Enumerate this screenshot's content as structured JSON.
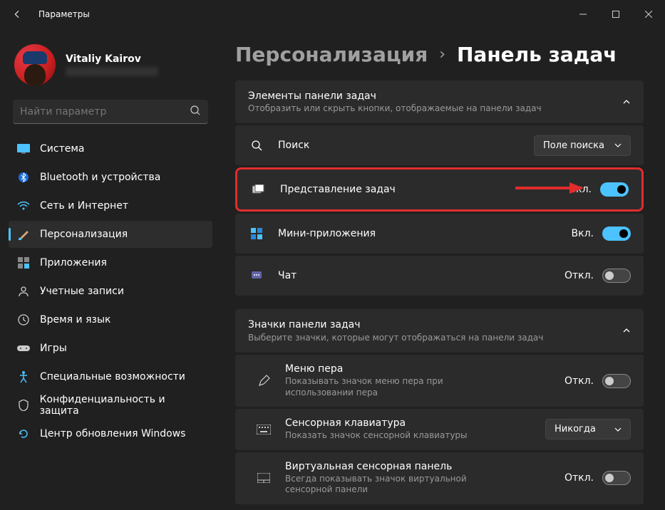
{
  "title": "Параметры",
  "user": {
    "name": "Vitaliy Kairov"
  },
  "search": {
    "placeholder": "Найти параметр"
  },
  "nav": [
    {
      "label": "Система",
      "icon": "display"
    },
    {
      "label": "Bluetooth и устройства",
      "icon": "bluetooth"
    },
    {
      "label": "Сеть и Интернет",
      "icon": "wifi"
    },
    {
      "label": "Персонализация",
      "icon": "brush",
      "active": true
    },
    {
      "label": "Приложения",
      "icon": "apps"
    },
    {
      "label": "Учетные записи",
      "icon": "user"
    },
    {
      "label": "Время и язык",
      "icon": "clock"
    },
    {
      "label": "Игры",
      "icon": "game"
    },
    {
      "label": "Специальные возможности",
      "icon": "accessibility"
    },
    {
      "label": "Конфиденциальность и защита",
      "icon": "shield"
    },
    {
      "label": "Центр обновления Windows",
      "icon": "update"
    }
  ],
  "breadcrumb": {
    "parent": "Персонализация",
    "sep": "›",
    "current": "Панель задач"
  },
  "section1": {
    "title": "Элементы панели задач",
    "desc": "Отобразить или скрыть кнопки, отображаемые на панели задач"
  },
  "rows": {
    "search": {
      "label": "Поиск",
      "dropdown": "Поле поиска"
    },
    "taskview": {
      "label": "Представление задач",
      "state": "Вкл."
    },
    "widgets": {
      "label": "Мини-приложения",
      "state": "Вкл."
    },
    "chat": {
      "label": "Чат",
      "state": "Откл."
    }
  },
  "section2": {
    "title": "Значки панели задач",
    "desc": "Выберите значки, которые могут отображаться на панели задач"
  },
  "rows2": {
    "pen": {
      "label": "Меню пера",
      "desc": "Показывать значок меню пера при использовании пера",
      "state": "Откл."
    },
    "touchkb": {
      "label": "Сенсорная клавиатура",
      "desc": "Показать значок сенсорной клавиатуры",
      "dropdown": "Никогда"
    },
    "touchpad": {
      "label": "Виртуальная сенсорная панель",
      "desc": "Всегда показывать значок виртуальной сенсорной панели",
      "state": "Откл."
    }
  }
}
